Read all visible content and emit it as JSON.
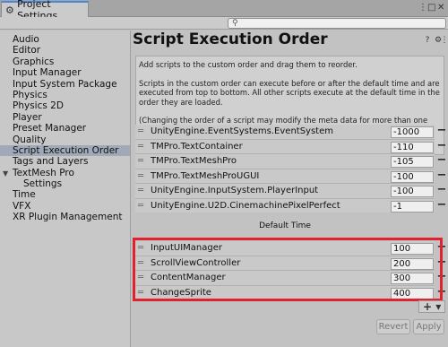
{
  "window": {
    "tab_title": "Project Settings",
    "tab_icon": "gear-icon",
    "menu_icon": "kebab-menu-icon",
    "maximize_icon": "maximize-icon",
    "close_icon": "close-icon"
  },
  "search": {
    "placeholder": "",
    "icon": "search-icon"
  },
  "sidebar": {
    "items": [
      {
        "label": "Audio"
      },
      {
        "label": "Editor"
      },
      {
        "label": "Graphics"
      },
      {
        "label": "Input Manager"
      },
      {
        "label": "Input System Package"
      },
      {
        "label": "Physics"
      },
      {
        "label": "Physics 2D"
      },
      {
        "label": "Player"
      },
      {
        "label": "Preset Manager"
      },
      {
        "label": "Quality"
      },
      {
        "label": "Script Execution Order",
        "selected": true
      },
      {
        "label": "Tags and Layers"
      },
      {
        "label": "TextMesh Pro",
        "expanded": true
      },
      {
        "label": "Settings",
        "child": true
      },
      {
        "label": "Time"
      },
      {
        "label": "VFX"
      },
      {
        "label": "XR Plugin Management"
      }
    ]
  },
  "main": {
    "title": "Script Execution Order",
    "help_icon": "help-icon",
    "settings_icon": "settings-icon",
    "more_icon": "more-icon",
    "help_lines": [
      "Add scripts to the custom order and drag them to reorder.",
      "Scripts in the custom order can execute before or after the default time and are executed from top to bottom. All other scripts execute at the default time in the order they are loaded.",
      "(Changing the order of a script may modify the meta data for more than one script.)"
    ],
    "before_rows": [
      {
        "name": "UnityEngine.EventSystems.EventSystem",
        "value": "-1000"
      },
      {
        "name": "TMPro.TextContainer",
        "value": "-110"
      },
      {
        "name": "TMPro.TextMeshPro",
        "value": "-105"
      },
      {
        "name": "TMPro.TextMeshProUGUI",
        "value": "-100"
      },
      {
        "name": "UnityEngine.InputSystem.PlayerInput",
        "value": "-100"
      },
      {
        "name": "UnityEngine.U2D.CinemachinePixelPerfect",
        "value": "-1"
      }
    ],
    "default_time_label": "Default Time",
    "after_rows": [
      {
        "name": "InputUIManager",
        "value": "100"
      },
      {
        "name": "ScrollViewController",
        "value": "200"
      },
      {
        "name": "ContentManager",
        "value": "300"
      },
      {
        "name": "ChangeSprite",
        "value": "400"
      }
    ],
    "remove_label": "−",
    "handle_glyph": "═",
    "add_label": "+ ▾",
    "revert_label": "Revert",
    "apply_label": "Apply"
  },
  "colors": {
    "highlight": "#e0222e",
    "selected_row": "#9fa9b7",
    "tab_accent": "#4b87d6"
  }
}
